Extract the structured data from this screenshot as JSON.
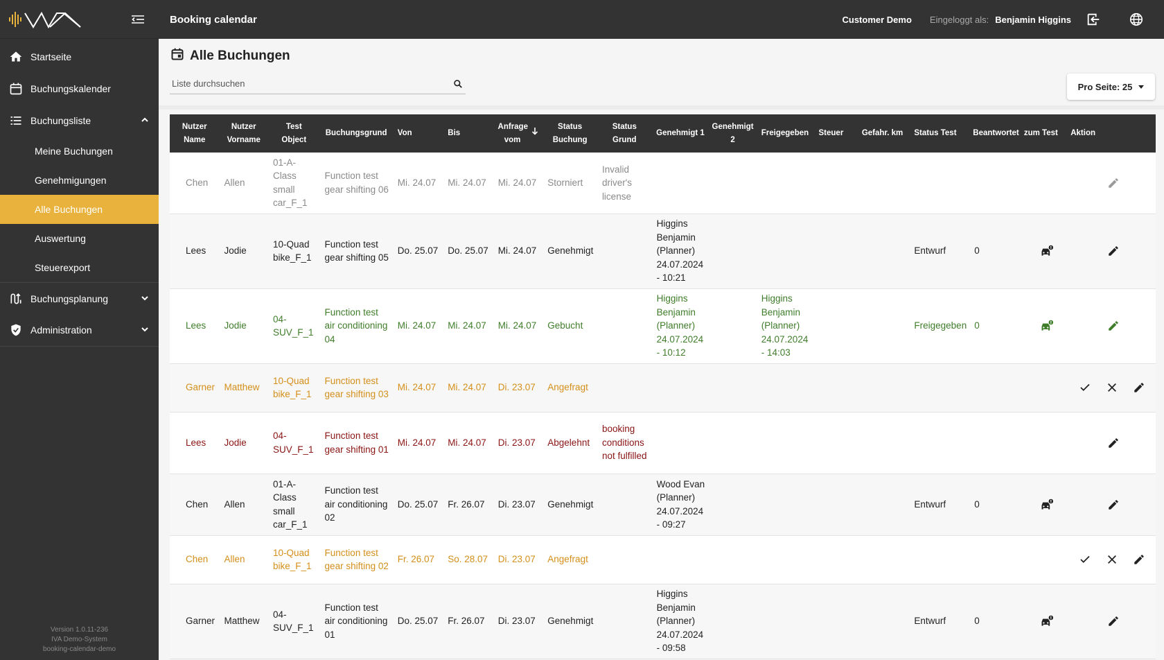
{
  "app": {
    "page_title": "Booking calendar",
    "customer": "Customer Demo",
    "logged_in_label": "Eingeloggt als:",
    "user": "Benjamin Higgins"
  },
  "sidebar": {
    "items": [
      {
        "label": "Startseite",
        "icon": "home-icon"
      },
      {
        "label": "Buchungskalender",
        "icon": "calendar-icon"
      },
      {
        "label": "Buchungsliste",
        "icon": "list-icon",
        "expanded": true
      },
      {
        "label": "Buchungsplanung",
        "icon": "planning-icon",
        "expanded": false
      },
      {
        "label": "Administration",
        "icon": "shield-icon",
        "expanded": false
      }
    ],
    "subitems": [
      "Meine Buchungen",
      "Genehmigungen",
      "Alle Buchungen",
      "Auswertung",
      "Steuerexport"
    ],
    "active_subitem": "Alle Buchungen",
    "version_lines": [
      "Version 1.0.11-236",
      "IVA Demo-System",
      "booking-calendar-demo"
    ]
  },
  "main": {
    "heading": "Alle Buchungen",
    "search_placeholder": "Liste durchsuchen",
    "per_page_label": "Pro Seite: 25"
  },
  "table": {
    "headers": [
      "Nutzer Name",
      "Nutzer Vorname",
      "Test Object",
      "Buchungsgrund",
      "Von",
      "Bis",
      "Anfrage vom",
      "Status Buchung",
      "Status Grund",
      "Genehmigt 1",
      "Genehmigt 2",
      "Freigegeben",
      "Steuer",
      "Gefahr. km",
      "Status Test",
      "Beantwortet",
      "zum Test",
      "Aktion"
    ],
    "sorted_column": "Anfrage vom",
    "rows": [
      {
        "status_class": "storniert",
        "name": "Chen",
        "vorname": "Allen",
        "object": "01-A-Class small car_F_1",
        "grund": "Function test gear shifting 06",
        "von": "Mi. 24.07",
        "bis": "Mi. 24.07",
        "anfrage": "Mi. 24.07",
        "status": "Storniert",
        "status_grund": "Invalid driver's license",
        "genehmigt1": "",
        "genehmigt2": "",
        "freigegeben": "",
        "steuer": "",
        "km": "",
        "status_test": "",
        "beantwortet": "",
        "to_test": false,
        "actions": [
          "edit"
        ]
      },
      {
        "status_class": "genehmigt",
        "name": "Lees",
        "vorname": "Jodie",
        "object": "10-Quad bike_F_1",
        "grund": "Function test gear shifting 05",
        "von": "Do. 25.07",
        "bis": "Do. 25.07",
        "anfrage": "Mi. 24.07",
        "status": "Genehmigt",
        "status_grund": "",
        "genehmigt1": "Higgins Benjamin (Planner) 24.07.2024 - 10:21",
        "genehmigt2": "",
        "freigegeben": "",
        "steuer": "",
        "km": "",
        "status_test": "Entwurf",
        "beantwortet": "0",
        "to_test": true,
        "actions": [
          "edit"
        ]
      },
      {
        "status_class": "gebucht",
        "name": "Lees",
        "vorname": "Jodie",
        "object": "04-SUV_F_1",
        "grund": "Function test air conditioning 04",
        "von": "Mi. 24.07",
        "bis": "Mi. 24.07",
        "anfrage": "Mi. 24.07",
        "status": "Gebucht",
        "status_grund": "",
        "genehmigt1": "Higgins Benjamin (Planner) 24.07.2024 - 10:12",
        "genehmigt2": "",
        "freigegeben": "Higgins Benjamin (Planner) 24.07.2024 - 14:03",
        "steuer": "",
        "km": "",
        "status_test": "Freigegeben",
        "beantwortet": "0",
        "to_test": true,
        "actions": [
          "edit"
        ]
      },
      {
        "status_class": "angefragt",
        "name": "Garner",
        "vorname": "Matthew",
        "object": "10-Quad bike_F_1",
        "grund": "Function test gear shifting 03",
        "von": "Mi. 24.07",
        "bis": "Mi. 24.07",
        "anfrage": "Di. 23.07",
        "status": "Angefragt",
        "status_grund": "",
        "genehmigt1": "",
        "genehmigt2": "",
        "freigegeben": "",
        "steuer": "",
        "km": "",
        "status_test": "",
        "beantwortet": "",
        "to_test": false,
        "actions": [
          "approve",
          "reject",
          "edit"
        ]
      },
      {
        "status_class": "abgelehnt",
        "name": "Lees",
        "vorname": "Jodie",
        "object": "04-SUV_F_1",
        "grund": "Function test gear shifting 01",
        "von": "Mi. 24.07",
        "bis": "Mi. 24.07",
        "anfrage": "Di. 23.07",
        "status": "Abgelehnt",
        "status_grund": "booking conditions not fulfilled",
        "genehmigt1": "",
        "genehmigt2": "",
        "freigegeben": "",
        "steuer": "",
        "km": "",
        "status_test": "",
        "beantwortet": "",
        "to_test": false,
        "actions": [
          "edit"
        ]
      },
      {
        "status_class": "genehmigt",
        "name": "Chen",
        "vorname": "Allen",
        "object": "01-A-Class small car_F_1",
        "grund": "Function test air conditioning 02",
        "von": "Do. 25.07",
        "bis": "Fr. 26.07",
        "anfrage": "Di. 23.07",
        "status": "Genehmigt",
        "status_grund": "",
        "genehmigt1": "Wood Evan (Planner) 24.07.2024 - 09:27",
        "genehmigt2": "",
        "freigegeben": "",
        "steuer": "",
        "km": "",
        "status_test": "Entwurf",
        "beantwortet": "0",
        "to_test": true,
        "actions": [
          "edit"
        ]
      },
      {
        "status_class": "angefragt",
        "name": "Chen",
        "vorname": "Allen",
        "object": "10-Quad bike_F_1",
        "grund": "Function test gear shifting 02",
        "von": "Fr. 26.07",
        "bis": "So. 28.07",
        "anfrage": "Di. 23.07",
        "status": "Angefragt",
        "status_grund": "",
        "genehmigt1": "",
        "genehmigt2": "",
        "freigegeben": "",
        "steuer": "",
        "km": "",
        "status_test": "",
        "beantwortet": "",
        "to_test": false,
        "actions": [
          "approve",
          "reject",
          "edit"
        ]
      },
      {
        "status_class": "genehmigt",
        "name": "Garner",
        "vorname": "Matthew",
        "object": "04-SUV_F_1",
        "grund": "Function test air conditioning 01",
        "von": "Do. 25.07",
        "bis": "Fr. 26.07",
        "anfrage": "Di. 23.07",
        "status": "Genehmigt",
        "status_grund": "",
        "genehmigt1": "Higgins Benjamin (Planner) 24.07.2024 - 09:58",
        "genehmigt2": "",
        "freigegeben": "",
        "steuer": "",
        "km": "",
        "status_test": "Entwurf",
        "beantwortet": "0",
        "to_test": true,
        "actions": [
          "edit"
        ]
      }
    ]
  },
  "colors": {
    "chrome": "#333333",
    "accent": "#e8b23c",
    "storniert": "#8a8a8a",
    "gebucht": "#3f7d2a",
    "angefragt": "#d48f1a",
    "abgelehnt": "#8b1414"
  }
}
